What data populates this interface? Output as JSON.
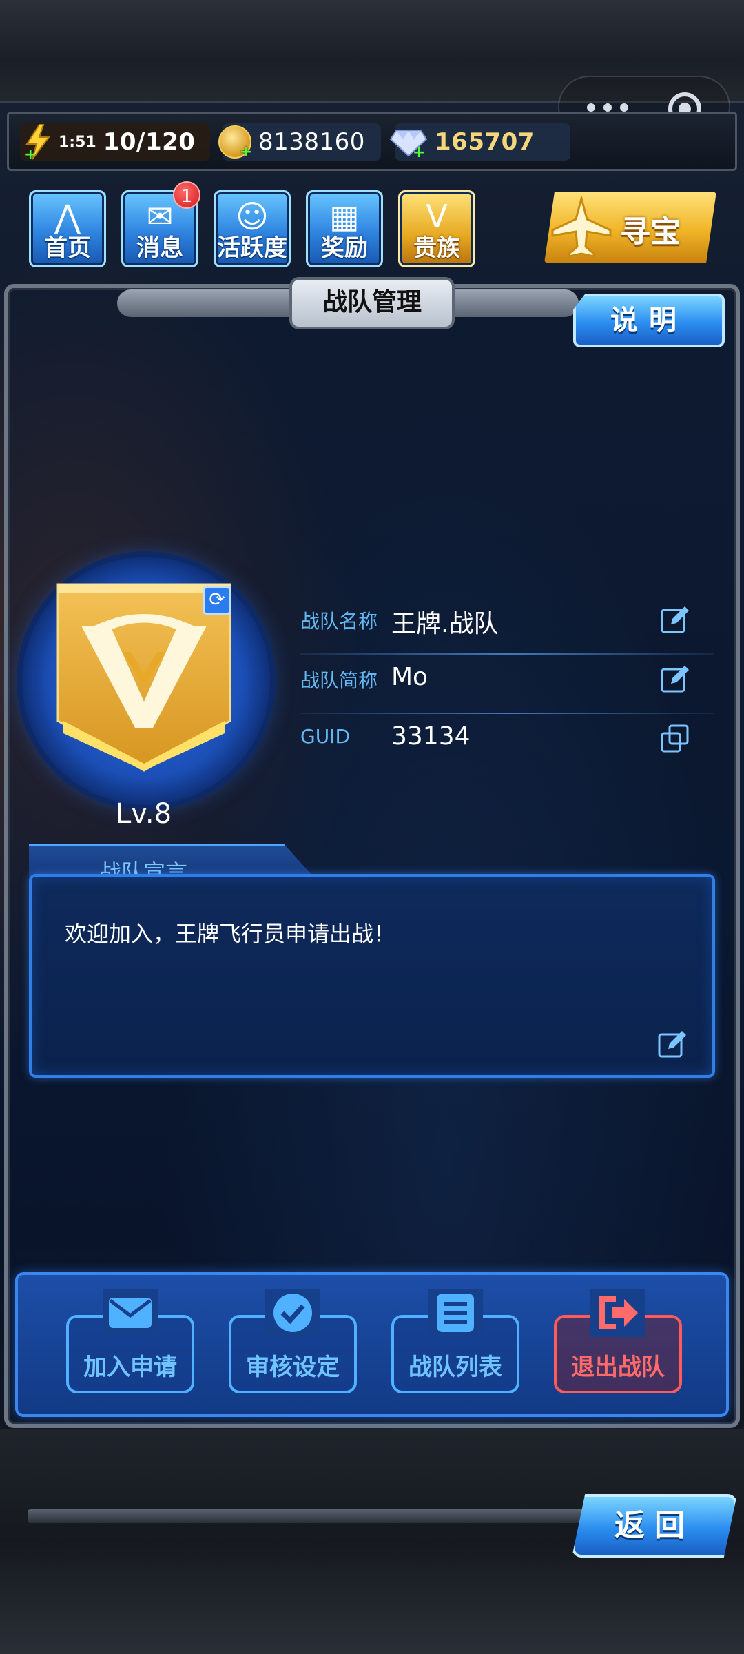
{
  "status": {
    "energy_timer": "1:51",
    "energy": "10/120",
    "gold": "8138160",
    "gems": "165707"
  },
  "nav": {
    "home": "首页",
    "messages": "消息",
    "messages_badge": "1",
    "activity": "活跃度",
    "rewards": "奖励",
    "noble": "贵族",
    "treasure": "寻宝"
  },
  "panel": {
    "title": "战队管理",
    "explain": "说明"
  },
  "team": {
    "level": "Lv.8",
    "name_label": "战队名称",
    "name": "王牌.战队",
    "short_label": "战队简称",
    "short": "Mo",
    "guid_label": "GUID",
    "guid": "33134"
  },
  "declaration": {
    "title": "战队宣言",
    "text": "欢迎加入，王牌飞行员申请出战！"
  },
  "actions": {
    "join_requests": "加入申请",
    "review_settings": "审核设定",
    "team_list": "战队列表",
    "leave_team": "退出战队"
  },
  "footer": {
    "back": "返回"
  },
  "colors": {
    "accent_blue": "#2f7fe8",
    "label_blue": "#63b8f3",
    "danger_red": "#ff5b5b",
    "gem_gold": "#f4d77a"
  }
}
